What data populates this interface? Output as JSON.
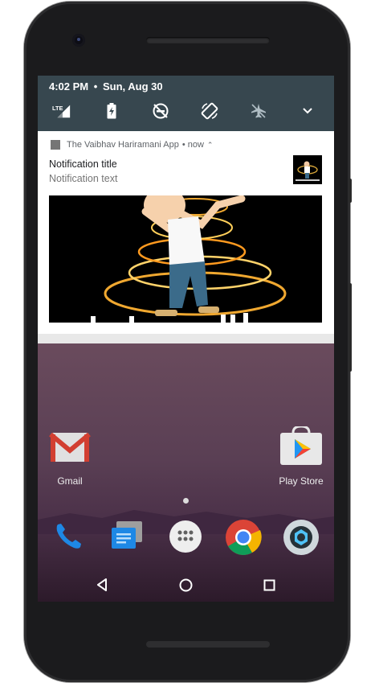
{
  "status": {
    "time": "4:02 PM",
    "separator": "•",
    "date": "Sun, Aug 30"
  },
  "quick_settings": [
    {
      "name": "lte-signal-icon",
      "label": "LTE"
    },
    {
      "name": "battery-charging-icon"
    },
    {
      "name": "do-not-disturb-icon"
    },
    {
      "name": "auto-rotate-icon"
    },
    {
      "name": "airplane-mode-icon"
    },
    {
      "name": "expand-chevron-icon"
    }
  ],
  "notification": {
    "app_name": "The Vaibhav Hariramani App",
    "time": "• now",
    "title": "Notification title",
    "text": "Notification text"
  },
  "home": {
    "apps": [
      {
        "label": "Gmail"
      },
      {
        "label": "Play Store"
      }
    ],
    "dock": [
      "phone-icon",
      "messages-icon",
      "app-drawer-icon",
      "chrome-icon",
      "camera-icon"
    ]
  },
  "navbar": [
    "back-button",
    "home-button",
    "recents-button"
  ],
  "colors": {
    "shade": "#37474f",
    "notification_bg": "#ffffff",
    "accent": "#1a73e8"
  }
}
